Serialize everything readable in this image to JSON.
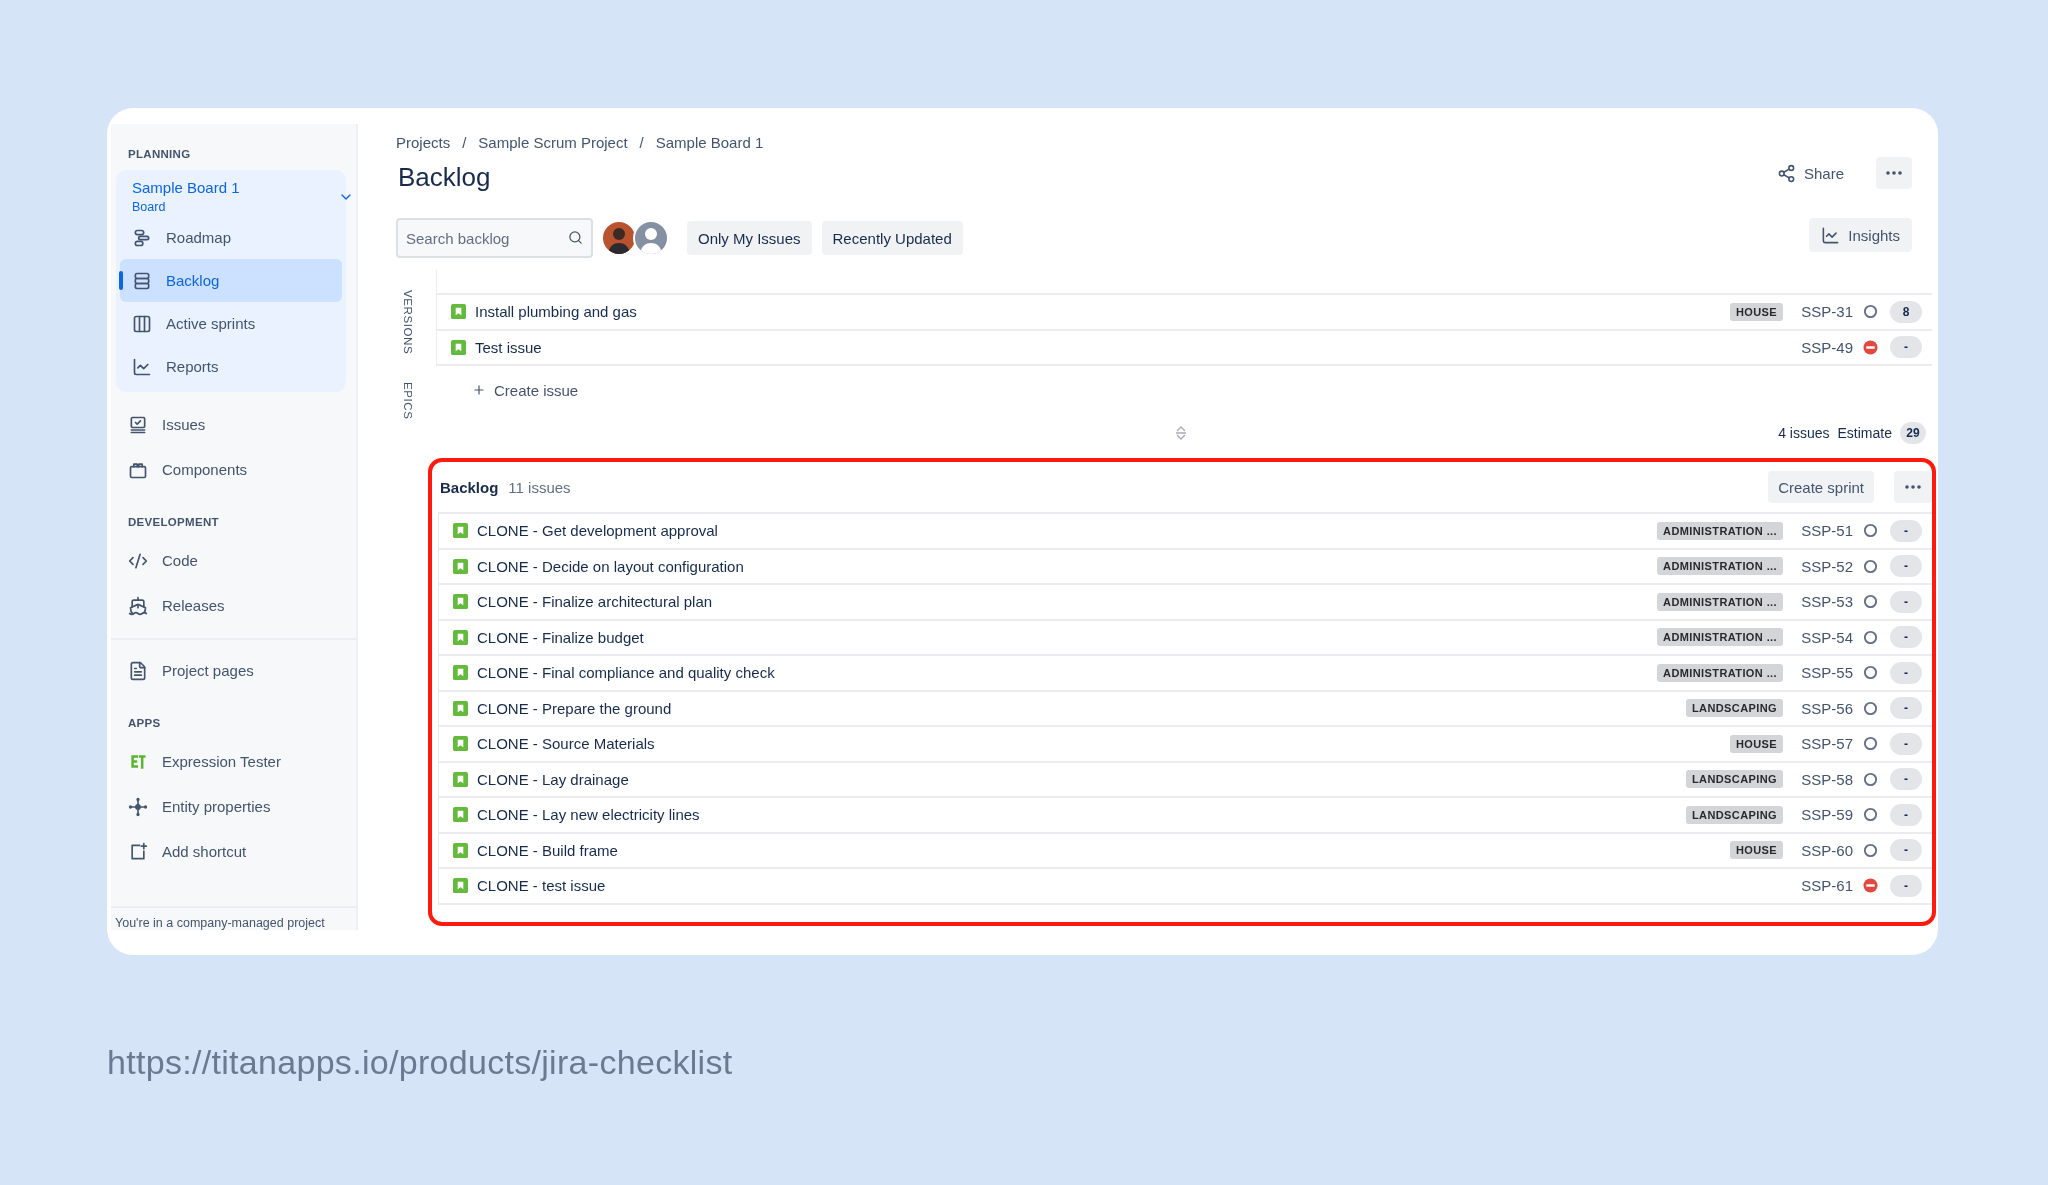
{
  "sidebar": {
    "sections": [
      {
        "heading": "PLANNING",
        "board": {
          "title": "Sample Board 1",
          "subtitle": "Board",
          "expanded": true,
          "items": [
            {
              "label": "Roadmap",
              "selected": false
            },
            {
              "label": "Backlog",
              "selected": true
            },
            {
              "label": "Active sprints",
              "selected": false
            },
            {
              "label": "Reports",
              "selected": false
            }
          ]
        },
        "items": [
          {
            "label": "Issues",
            "selected": false
          },
          {
            "label": "Components",
            "selected": false
          }
        ]
      },
      {
        "heading": "DEVELOPMENT",
        "items": [
          {
            "label": "Code",
            "selected": false
          },
          {
            "label": "Releases",
            "selected": false
          }
        ]
      },
      {
        "items": [
          {
            "label": "Project pages",
            "selected": false
          }
        ]
      },
      {
        "heading": "APPS",
        "items": [
          {
            "label": "Expression Tester",
            "selected": false
          },
          {
            "label": "Entity properties",
            "selected": false
          },
          {
            "label": "Add shortcut",
            "selected": false
          }
        ]
      }
    ],
    "footer": "You're in a company-managed project"
  },
  "breadcrumbs": [
    "Projects",
    "Sample Scrum Project",
    "Sample Board 1"
  ],
  "breadcrumb_separator": "/",
  "title": "Backlog",
  "share": "Share",
  "toolbar": {
    "search": {
      "placeholder": "Search backlog"
    },
    "avatars": [
      {
        "kind": "photo"
      },
      {
        "kind": "default"
      }
    ],
    "filters": [
      {
        "label": "Only My Issues",
        "selected": false
      },
      {
        "label": "Recently Updated",
        "selected": false
      }
    ],
    "insights": "Insights"
  },
  "side_tabs": [
    "VERSIONS",
    "EPICS"
  ],
  "sprint": {
    "issues": [
      {
        "title": "Install plumbing and gas",
        "tag": "HOUSE",
        "key": "SSP-31",
        "blocked": false,
        "estimate": "8"
      },
      {
        "title": "Test issue",
        "key": "SSP-49",
        "blocked": true,
        "estimate": "-"
      }
    ],
    "create_issue": "Create issue",
    "issue_count": "4 issues",
    "estimate_label": "Estimate",
    "estimate_total": "29"
  },
  "backlog": {
    "title": "Backlog",
    "issue_count": "11 issues",
    "create_sprint": "Create sprint",
    "highlighted": true,
    "issues": [
      {
        "title": "CLONE - Get development approval",
        "tag": "ADMINISTRATION ...",
        "key": "SSP-51",
        "blocked": false,
        "estimate": "-"
      },
      {
        "title": "CLONE - Decide on layout configuration",
        "tag": "ADMINISTRATION ...",
        "key": "SSP-52",
        "blocked": false,
        "estimate": "-"
      },
      {
        "title": "CLONE - Finalize architectural plan",
        "tag": "ADMINISTRATION ...",
        "key": "SSP-53",
        "blocked": false,
        "estimate": "-"
      },
      {
        "title": "CLONE - Finalize budget",
        "tag": "ADMINISTRATION ...",
        "key": "SSP-54",
        "blocked": false,
        "estimate": "-"
      },
      {
        "title": "CLONE - Final compliance and quality check",
        "tag": "ADMINISTRATION ...",
        "key": "SSP-55",
        "blocked": false,
        "estimate": "-"
      },
      {
        "title": "CLONE - Prepare the ground",
        "tag": "LANDSCAPING",
        "key": "SSP-56",
        "blocked": false,
        "estimate": "-"
      },
      {
        "title": "CLONE - Source Materials",
        "tag": "HOUSE",
        "key": "SSP-57",
        "blocked": false,
        "estimate": "-"
      },
      {
        "title": "CLONE - Lay drainage",
        "tag": "LANDSCAPING",
        "key": "SSP-58",
        "blocked": false,
        "estimate": "-"
      },
      {
        "title": "CLONE - Lay new electricity lines",
        "tag": "LANDSCAPING",
        "key": "SSP-59",
        "blocked": false,
        "estimate": "-"
      },
      {
        "title": "CLONE - Build frame",
        "tag": "HOUSE",
        "key": "SSP-60",
        "blocked": false,
        "estimate": "-"
      },
      {
        "title": "CLONE - test issue",
        "key": "SSP-61",
        "blocked": true,
        "estimate": "-"
      }
    ]
  },
  "footer_url": "https://titanapps.io/products/jira-checklist"
}
